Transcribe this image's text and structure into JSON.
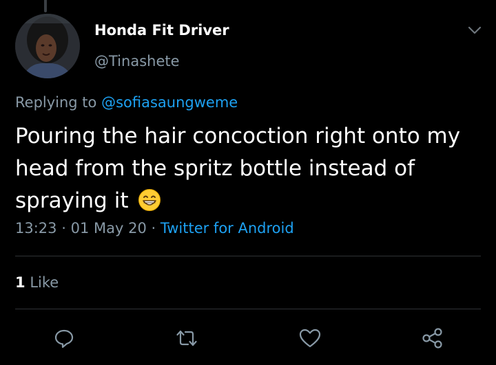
{
  "user": {
    "display_name": "Honda Fit Driver",
    "handle": "@Tinashete"
  },
  "reply": {
    "prefix": "Replying to",
    "mention": "@sofiasaungweme"
  },
  "tweet": {
    "text": "Pouring the hair concoction right onto my head from the spritz bottle instead of spraying it",
    "emoji": "grinning-face-with-smiling-eyes"
  },
  "meta": {
    "time": "13:23",
    "date": "01 May 20",
    "separator": "·",
    "source": "Twitter for Android"
  },
  "engagement": {
    "like_count": "1",
    "like_label": "Like"
  },
  "actions": [
    "reply-icon",
    "retweet-icon",
    "like-icon",
    "share-icon"
  ],
  "colors": {
    "background": "#000000",
    "text": "#ffffff",
    "secondary": "#8899a6",
    "link": "#1da1f2",
    "divider": "#2f3336"
  }
}
